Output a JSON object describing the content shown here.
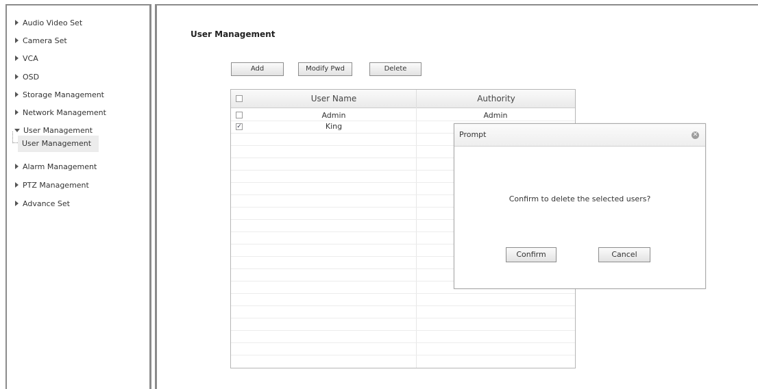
{
  "sidebar": {
    "items": [
      {
        "label": "Audio Video Set",
        "expanded": false
      },
      {
        "label": "Camera Set",
        "expanded": false
      },
      {
        "label": "VCA",
        "expanded": false
      },
      {
        "label": "OSD",
        "expanded": false
      },
      {
        "label": "Storage Management",
        "expanded": false
      },
      {
        "label": "Network Management",
        "expanded": false
      },
      {
        "label": "User Management",
        "expanded": true
      },
      {
        "label": "Alarm Management",
        "expanded": false
      },
      {
        "label": "PTZ Management",
        "expanded": false
      },
      {
        "label": "Advance Set",
        "expanded": false
      }
    ],
    "sub_item": "User Management"
  },
  "page": {
    "title": "User Management"
  },
  "toolbar": {
    "add": "Add",
    "modify": "Modify Pwd",
    "delete": "Delete"
  },
  "table": {
    "headers": [
      "User Name",
      "Authority"
    ],
    "rows": [
      {
        "name": "Admin",
        "authority": "Admin",
        "checked": false
      },
      {
        "name": "King",
        "authority": "",
        "checked": true
      }
    ]
  },
  "dialog": {
    "title": "Prompt",
    "message": "Confirm to delete the selected users?",
    "confirm": "Confirm",
    "cancel": "Cancel"
  }
}
